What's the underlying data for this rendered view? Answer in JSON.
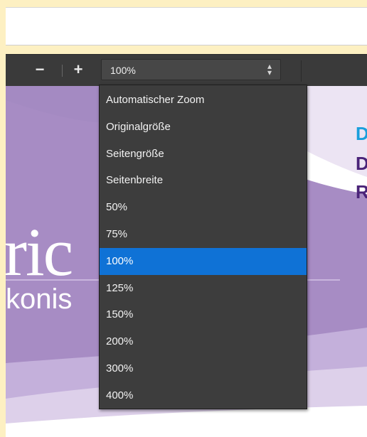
{
  "toolbar": {
    "zoom_out_label": "−",
    "zoom_in_label": "+",
    "zoom_select": {
      "value": "100%",
      "arrow_icon": "select-updown-arrows-icon"
    }
  },
  "zoom_dropdown": {
    "options": [
      "Automatischer Zoom",
      "Originalgröße",
      "Seitengröße",
      "Seitenbreite",
      "50%",
      "75%",
      "100%",
      "125%",
      "150%",
      "200%",
      "300%",
      "400%"
    ],
    "selected": "100%"
  },
  "page": {
    "big_text": "ric",
    "sub_text": "konis",
    "right_letters": [
      {
        "text": "D",
        "color": "#1a9fdc"
      },
      {
        "text": "D",
        "color": "#4a2378"
      },
      {
        "text": "R",
        "color": "#4a2378"
      }
    ]
  },
  "colors": {
    "toolbar_bg": "#3a3a3a",
    "dropdown_bg": "#3d3d3d",
    "selected_bg": "#0f72d6",
    "page_purple": "#a78cc4",
    "outer_bg": "#fdf0c2"
  }
}
